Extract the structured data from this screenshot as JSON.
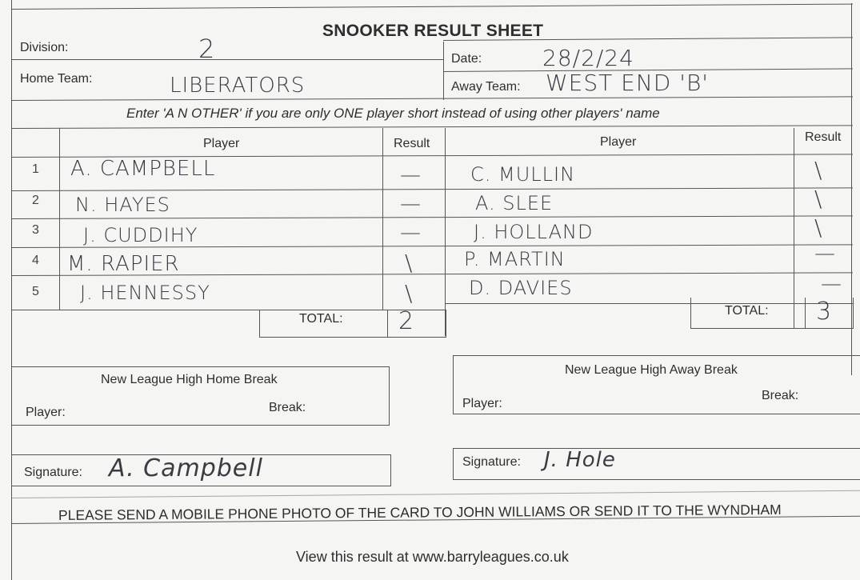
{
  "sheet": {
    "title": "SNOOKER RESULT SHEET",
    "division_label": "Division:",
    "division_value": "2",
    "date_label": "Date:",
    "date_value": "28/2/24",
    "home_team_label": "Home Team:",
    "home_team_value": "LIBERATORS",
    "away_team_label": "Away Team:",
    "away_team_value": "WEST END 'B'",
    "instruction": "Enter 'A N OTHER' if you are only ONE player short instead of using other players' name"
  },
  "table": {
    "player_header": "Player",
    "result_header": "Result",
    "rows": [
      {
        "num": "1",
        "home_player": "A. CAMPBELL",
        "home_result": "—",
        "away_player": "C. MULLIN",
        "away_result": "\\"
      },
      {
        "num": "2",
        "home_player": "N. HAYES",
        "home_result": "—",
        "away_player": "A. SLEE",
        "away_result": "\\"
      },
      {
        "num": "3",
        "home_player": "J. CUDDIHY",
        "home_result": "—",
        "away_player": "J. HOLLAND",
        "away_result": "\\"
      },
      {
        "num": "4",
        "home_player": "M. RAPIER",
        "home_result": "\\",
        "away_player": "P. MARTIN",
        "away_result": "—"
      },
      {
        "num": "5",
        "home_player": "J. HENNESSY",
        "home_result": "\\",
        "away_player": "D. DAVIES",
        "away_result": "—"
      }
    ],
    "total_label": "TOTAL:",
    "home_total": "2",
    "away_total": "3"
  },
  "breaks": {
    "home_title": "New League High Home Break",
    "away_title": "New League High Away Break",
    "player_label": "Player:",
    "break_label": "Break:"
  },
  "signatures": {
    "label": "Signature:",
    "home_signature": "A. Campbell",
    "away_signature": "J. Hole"
  },
  "footer": {
    "send_note": "PLEASE SEND A MOBILE PHONE PHOTO OF THE CARD TO JOHN WILLIAMS OR SEND IT TO THE WYNDHAM",
    "view_note": "View this result at www.barryleagues.co.uk"
  }
}
